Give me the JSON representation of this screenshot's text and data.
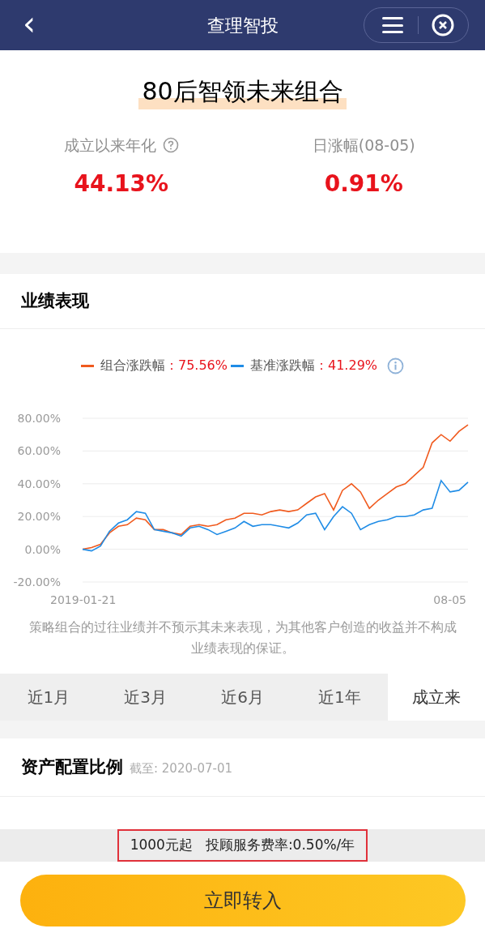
{
  "header": {
    "back": "‹",
    "title": "查理智投"
  },
  "portfolio": {
    "name": "80后智领未来组合",
    "stats": [
      {
        "label": "成立以来年化",
        "help": true,
        "value": "44.13%"
      },
      {
        "label": "日涨幅(08-05)",
        "help": false,
        "value": "0.91%"
      }
    ]
  },
  "performance": {
    "title": "业绩表现",
    "legend": [
      {
        "value": "：75.56%"
      },
      {
        "value": "：41.29%"
      }
    ],
    "x_labels": [
      "2019-01-21",
      "08-05"
    ],
    "chart_data": {
      "type": "line",
      "grid": true,
      "ylim": [
        -20,
        80
      ],
      "yticks": [
        {
          "value": 80,
          "label": "80.00%"
        },
        {
          "value": 60,
          "label": "60.00%"
        },
        {
          "value": 40,
          "label": "40.00%"
        },
        {
          "value": 20,
          "label": "20.00%"
        },
        {
          "value": 0,
          "label": "0.00%"
        },
        {
          "value": -20,
          "label": "-20.00%"
        }
      ],
      "series": [
        {
          "name": "组合涨跌幅",
          "color": "#f05a1e",
          "values": [
            0,
            1,
            3,
            10,
            14,
            15,
            19,
            18,
            12,
            12,
            10,
            9,
            14,
            15,
            14,
            15,
            18,
            19,
            22,
            22,
            21,
            23,
            24,
            23,
            24,
            28,
            32,
            34,
            24,
            36,
            40,
            35,
            25,
            30,
            34,
            38,
            40,
            45,
            50,
            65,
            70,
            66,
            72,
            76
          ]
        },
        {
          "name": "基准涨跌幅",
          "color": "#1f8ce6",
          "values": [
            0,
            -1,
            2,
            11,
            16,
            18,
            23,
            22,
            12,
            11,
            10,
            8,
            13,
            14,
            12,
            9,
            11,
            13,
            17,
            14,
            15,
            15,
            14,
            13,
            16,
            21,
            22,
            12,
            20,
            26,
            22,
            12,
            15,
            17,
            18,
            20,
            20,
            21,
            24,
            25,
            42,
            35,
            36,
            41
          ]
        }
      ]
    },
    "disclaimer": "策略组合的过往业绩并不预示其未来表现，为其他客户创造的收益并不构成业绩表现的保证。",
    "periods": [
      {
        "label": "近1月",
        "selected": false
      },
      {
        "label": "近3月",
        "selected": false
      },
      {
        "label": "近6月",
        "selected": false
      },
      {
        "label": "近1年",
        "selected": false
      },
      {
        "label": "成立来",
        "selected": true
      }
    ]
  },
  "allocation": {
    "title": "资产配置比例",
    "as_of": "截至: 2020-07-01"
  },
  "fee_bar": {
    "highlighted": true,
    "minimum": "1000元起",
    "fee": "投顾服务费率:0.50%/年"
  },
  "cta": "立即转入"
}
